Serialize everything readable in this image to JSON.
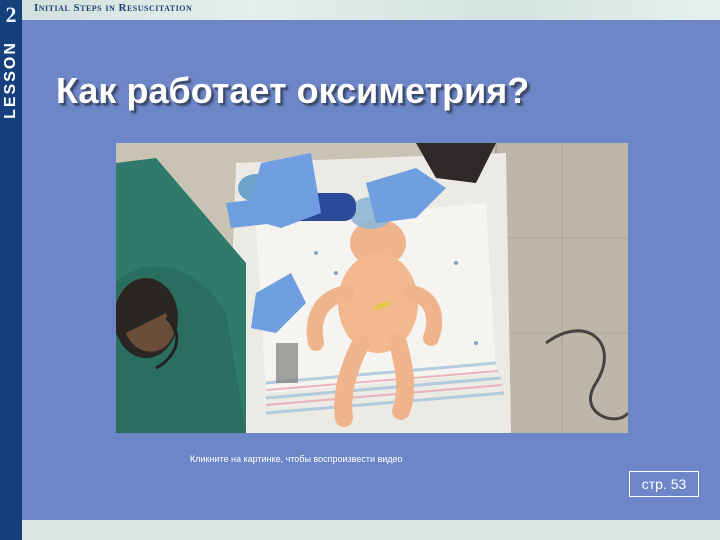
{
  "header": {
    "banner_title": "Initial Steps in Resuscitation",
    "lesson_number": "2",
    "lesson_label": "LESSON"
  },
  "slide": {
    "title": "Как работает оксиметрия?",
    "video_caption": "Кликните на картинке, чтобы воспроизвести видео",
    "page_ref": "стр. 53"
  },
  "colors": {
    "sidebar": "#16407c",
    "panel": "#6d86c7",
    "title_text": "#ffffff"
  }
}
